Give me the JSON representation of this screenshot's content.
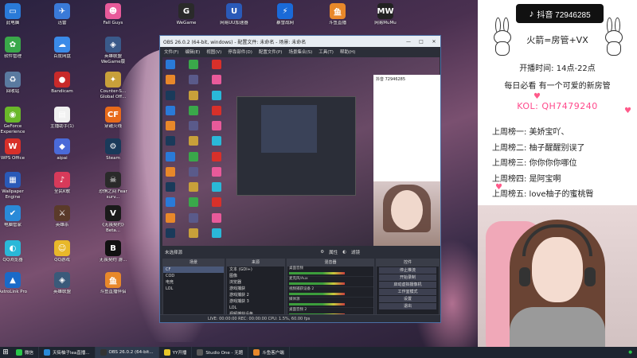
{
  "desktop": {
    "icons": [
      {
        "label": "此电脑",
        "color": "#2a7ad8",
        "glyph": "▭"
      },
      {
        "label": "软件管理",
        "color": "#3aa84a",
        "glyph": "✿"
      },
      {
        "label": "回收站",
        "color": "#5a7aa0",
        "glyph": "♻"
      },
      {
        "label": "GeForce Experience",
        "color": "#6ab82a",
        "glyph": "◉"
      },
      {
        "label": "WPS Office",
        "color": "#d8302a",
        "glyph": "W"
      },
      {
        "label": "Wallpaper Engine",
        "color": "#2a5ab8",
        "glyph": "▦"
      },
      {
        "label": "电脑管家",
        "color": "#2a8ad8",
        "glyph": "✔"
      },
      {
        "label": "QQ浏览器",
        "color": "#2ab8d8",
        "glyph": "◐"
      },
      {
        "label": "AstroLink Pro",
        "color": "#1a6ac8",
        "glyph": "▲"
      },
      {
        "label": "迅雷",
        "color": "#3a7ad8",
        "glyph": "✈"
      },
      {
        "label": "百度网盘",
        "color": "#3a8ae8",
        "glyph": "☁"
      },
      {
        "label": "Bandicam",
        "color": "#c82a2a",
        "glyph": "●"
      },
      {
        "label": "主播助手(1)",
        "color": "#f0f0f0",
        "glyph": "▤"
      },
      {
        "label": "aipai",
        "color": "#4a6ad8",
        "glyph": "◆"
      },
      {
        "label": "全民K歌",
        "color": "#d83a5a",
        "glyph": "♪"
      },
      {
        "label": "英雄杀",
        "color": "#5a3a2a",
        "glyph": "⚔"
      },
      {
        "label": "QQ游戏",
        "color": "#e8b82a",
        "glyph": "☺"
      },
      {
        "label": "英雄联盟",
        "color": "#3a5a7a",
        "glyph": "◈"
      },
      {
        "label": "Fall Guys",
        "color": "#e85a9a",
        "glyph": "☻"
      },
      {
        "label": "英雄联盟 WeGame版",
        "color": "#3a5a8a",
        "glyph": "◈"
      },
      {
        "label": "Counter-S... Global Off...",
        "color": "#c8a03a",
        "glyph": "✦"
      },
      {
        "label": "穿越火线",
        "color": "#e86a1a",
        "glyph": "CF"
      },
      {
        "label": "Steam",
        "color": "#1a3a5a",
        "glyph": "⚙"
      },
      {
        "label": "恐惧之间 Fear surv...",
        "color": "#2a2a2a",
        "glyph": "☠"
      },
      {
        "label": "《无畏契约》Beta...",
        "color": "#1a1a1a",
        "glyph": "V"
      },
      {
        "label": "无畏契约 游...",
        "color": "#111111",
        "glyph": "B"
      },
      {
        "label": "斗鱼直播伴侣",
        "color": "#e8882a",
        "glyph": "鱼"
      },
      {
        "label": "WeGame",
        "color": "#2a2a2a",
        "glyph": "G"
      },
      {
        "label": "网易UU加速器",
        "color": "#2a5ab8",
        "glyph": "U"
      },
      {
        "label": "暴雪战网",
        "color": "#1a6ad8",
        "glyph": "⚡"
      },
      {
        "label": "斗鱼直播",
        "color": "#e8882a",
        "glyph": "鱼"
      },
      {
        "label": "网易MuMu",
        "color": "#222222",
        "glyph": "MW"
      }
    ]
  },
  "obs": {
    "title": "OBS 26.0.2 (64-bit, windows) - 配置文件: 未命名 - 场景: 未命名",
    "min": "—",
    "max": "□",
    "close": "✕",
    "menu": [
      "文件(F)",
      "编辑(E)",
      "视图(V)",
      "停靠部件(D)",
      "配置文件(P)",
      "场景集合(S)",
      "工具(T)",
      "帮助(H)"
    ],
    "source_bar": "未选择源",
    "props_btn": "属性",
    "filters_btn": "滤镜",
    "docks": {
      "scenes": {
        "title": "场景",
        "items": [
          "CF",
          "COD",
          "电竞",
          "LOL"
        ]
      },
      "sources": {
        "title": "来源",
        "items": [
          "文本 (GDI+)",
          "图像",
          "浏览器",
          "游戏捕获",
          "游戏捕获 2",
          "游戏捕获 3",
          "LOL",
          "视频捕获设备",
          "视频",
          "图片"
        ]
      },
      "mixer": {
        "title": "混音器",
        "channels": [
          "桌面音频",
          "麦克风/Aux",
          "视频捕获设备 2",
          "媒体源",
          "桌面音频 2",
          "音频"
        ]
      },
      "controls": {
        "title": "控件",
        "buttons": [
          "停止推流",
          "开始录制",
          "启动虚拟摄像机",
          "工作室模式",
          "设置",
          "退出"
        ]
      }
    },
    "dock_tabs": [
      "混音器",
      "转场特效"
    ],
    "status": "LIVE: 00:00:00   REC: 00:00:00   CPU: 1.5%, 60.00 fps"
  },
  "overlay": {
    "douyin_label": "抖音 72946285",
    "name_line": "火箭=房管+VX",
    "time_line": "开播时间: 14点-22点",
    "daily_line": "每日必看 有一个可爱的新房管",
    "kol_line": "KOL: QH7479240",
    "ranks": [
      "上周榜一: 美娇宝吖、",
      "上周榜二: 柚子醒醒别误了",
      "上周榜三: 你你你你哪位",
      "上周榜四: 是阿宝啊",
      "上周榜五: love柚子的蜜桃臀"
    ]
  },
  "taskbar": {
    "items": [
      {
        "label": "微信",
        "color": "#2ac84a",
        "active": false
      },
      {
        "label": "天街柚子lea直播...",
        "color": "#2a8ad8",
        "active": false
      },
      {
        "label": "OBS 26.0.2 (64-bit...",
        "color": "#333333",
        "active": true
      },
      {
        "label": "YY开播",
        "color": "#e8c82a",
        "active": false
      },
      {
        "label": "Studio One - 无题",
        "color": "#5a5a5a",
        "active": false
      },
      {
        "label": "斗鱼客户端",
        "color": "#e8882a",
        "active": false
      }
    ],
    "start": "⊞"
  }
}
